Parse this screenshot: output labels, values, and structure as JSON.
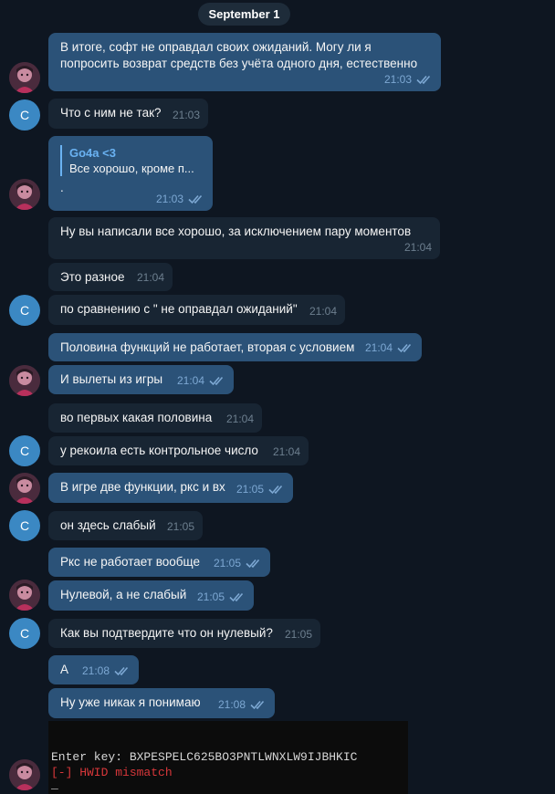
{
  "date_label": "September 1",
  "colors": {
    "background": "#0e1621",
    "outgoing": "#2b5278",
    "incoming": "#182533",
    "accent": "#6ab2f2",
    "avatar_letter_bg": "#3b88c3"
  },
  "avatars": {
    "contact_letter": "C"
  },
  "messages": [
    {
      "text": "В итоге, софт не оправдал своих ожиданий. Могу ли я попросить возврат средств без учёта одного дня, естественно",
      "time": "21:03"
    },
    {
      "text": "Что с ним не так?",
      "time": "21:03"
    },
    {
      "reply_name": "Go4a <3",
      "reply_text": "Все хорошо, кроме п...",
      "text": ".",
      "time": "21:03"
    },
    {
      "text": "Ну вы написали все хорошо, за исключением пару моментов",
      "time": "21:04"
    },
    {
      "text": "Это разное",
      "time": "21:04"
    },
    {
      "text": "по сравнению с \" не оправдал ожиданий\"",
      "time": "21:04"
    },
    {
      "text": "Половина функций не работает, вторая с условием",
      "time": "21:04"
    },
    {
      "text": "И вылеты из игры",
      "time": "21:04"
    },
    {
      "text": "во первых какая половина",
      "time": "21:04"
    },
    {
      "text": "у рекоила есть контрольное число",
      "time": "21:04"
    },
    {
      "text": "В игре две функции, ркс и вх",
      "time": "21:05"
    },
    {
      "text": "он здесь слабый",
      "time": "21:05"
    },
    {
      "text": "Ркс не работает вообще",
      "time": "21:05"
    },
    {
      "text": "Нулевой, а не слабый",
      "time": "21:05"
    },
    {
      "text": "Как вы подтвердите что он нулевый?",
      "time": "21:05"
    },
    {
      "text": "А",
      "time": "21:08"
    },
    {
      "text": "Ну уже никак я понимаю",
      "time": "21:08"
    }
  ],
  "terminal": {
    "line1": "Enter key: BXPESPELC625BO3PNTLWNXLW9IJBHKIC",
    "line2": "[-] HWID mismatch",
    "cursor": "_"
  }
}
